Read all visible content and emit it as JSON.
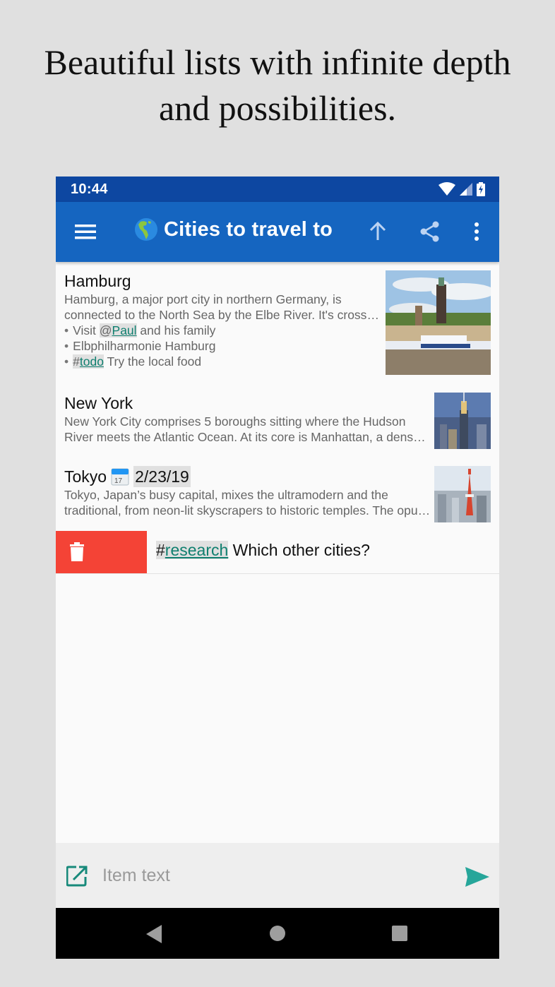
{
  "promo": {
    "line1": "Beautiful lists with infinite depth",
    "line2": "and possibilities."
  },
  "status_bar": {
    "time": "10:44",
    "icons": [
      "wifi-icon",
      "cell-signal-icon",
      "battery-charging-icon"
    ]
  },
  "app_bar": {
    "title_emoji": "globe-americas-icon",
    "title": "Cities to travel to",
    "actions": [
      "menu-icon",
      "arrow-up-icon",
      "share-icon",
      "more-vert-icon"
    ]
  },
  "colors": {
    "status_bar": "#0d47a1",
    "app_bar": "#1565c0",
    "accent": "#0f7f6f",
    "delete": "#f44336",
    "send": "#26a69a"
  },
  "list": {
    "items": [
      {
        "title": "Hamburg",
        "description": "Hamburg, a major port city in northern Germany, is connected to the North Sea by the Elbe River. It's crossed by hundreds of canals",
        "description_line1": "Hamburg, a major port city in northern Germany, is",
        "description_line2": "connected to the North Sea by the Elbe River. It's crossed by hundreds of canals",
        "bullets": [
          {
            "prefix": "Visit ",
            "tag_symbol": "@",
            "tag": "Paul",
            "suffix": " and his family"
          },
          {
            "text": "Elbphilharmonie Hamburg"
          },
          {
            "tag_symbol": "#",
            "tag": "todo",
            "suffix": " Try the local food"
          }
        ],
        "image": "hamburg-harbor-thumbnail"
      },
      {
        "title": "New York",
        "description_line1": "New York City comprises 5 boroughs sitting where the Hudson",
        "description_line2": "River meets the Atlantic Ocean. At its core is Manhattan, a densely populated borough",
        "image": "new-york-skyline-thumbnail"
      },
      {
        "title": "Tokyo",
        "date_icon": "calendar-icon",
        "date": "2/23/19",
        "description_line1": "Tokyo, Japan’s busy capital, mixes the ultramodern and the",
        "description_line2": "traditional, from neon-lit skyscrapers to historic temples. The opulent",
        "image": "tokyo-tower-thumbnail"
      }
    ],
    "swiped_item": {
      "tag_symbol": "#",
      "tag": "research",
      "text": " Which other cities?",
      "delete_icon": "trash-icon"
    }
  },
  "input_bar": {
    "placeholder": "Item text",
    "value": ""
  },
  "nav_bar": {
    "buttons": [
      "back",
      "home",
      "recents"
    ]
  }
}
